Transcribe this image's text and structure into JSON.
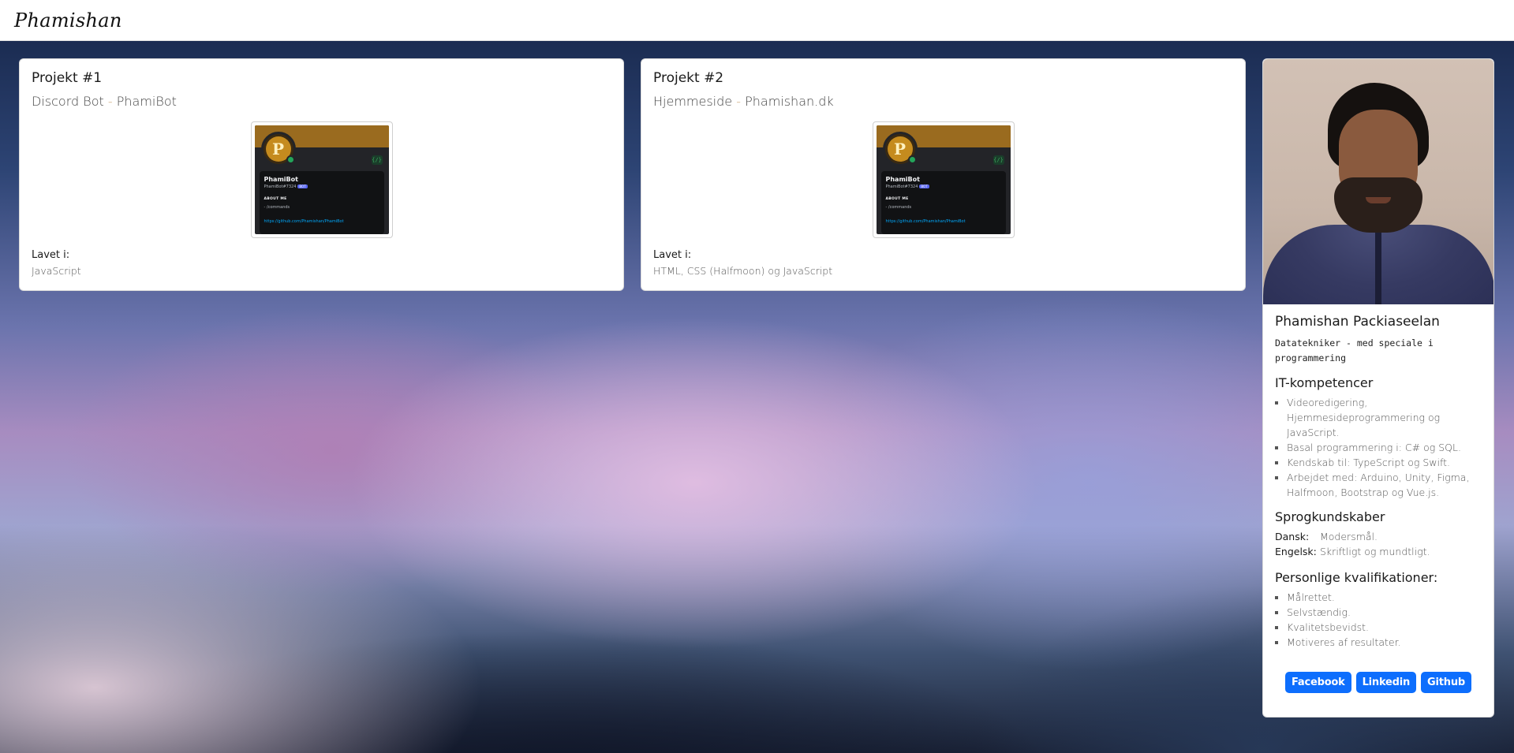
{
  "navbar": {
    "brand": "Phamishan"
  },
  "projects": [
    {
      "title": "Projekt #1",
      "name": "Discord Bot",
      "separator": "-",
      "product": "PhamiBot",
      "made_label": "Lavet i:",
      "made_value": "JavaScript",
      "preview": {
        "avatar_letter": "P",
        "dev_badge": "{/}",
        "bot_name": "PhamiBot",
        "bot_tag": "PhamiBot#7324",
        "bot_badge": "BOT",
        "about_label": "ABOUT ME",
        "commands": "- /commands",
        "link": "https://github.com/Phamishan/PhamiBot"
      }
    },
    {
      "title": "Projekt #2",
      "name": "Hjemmeside",
      "separator": "-",
      "product": "Phamishan.dk",
      "made_label": "Lavet i:",
      "made_value": "HTML, CSS (Halfmoon) og JavaScript",
      "preview": {
        "avatar_letter": "P",
        "dev_badge": "{/}",
        "bot_name": "PhamiBot",
        "bot_tag": "PhamiBot#7324",
        "bot_badge": "BOT",
        "about_label": "ABOUT ME",
        "commands": "- /commands",
        "link": "https://github.com/Phamishan/PhamiBot"
      }
    }
  ],
  "profile": {
    "name": "Phamishan Packiaseelan",
    "role": "Datatekniker - med speciale i programmering",
    "it_title": "IT-kompetencer",
    "it_items": [
      "Videoredigering, Hjemmesideprogrammering og JavaScript.",
      "Basal programmering i: C# og SQL.",
      "Kendskab til: TypeScript og Swift.",
      "Arbejdet med: Arduino, Unity, Figma, Halfmoon, Bootstrap og Vue.js."
    ],
    "lang_title": "Sprogkundskaber",
    "languages": [
      {
        "lang": "Dansk:",
        "level": "Modersmål."
      },
      {
        "lang": "Engelsk:",
        "level": "Skriftligt og mundtligt."
      }
    ],
    "personal_title": "Personlige kvalifikationer:",
    "personal_items": [
      "Målrettet.",
      "Selvstændig.",
      "Kvalitetsbevidst.",
      "Motiveres af resultater."
    ],
    "buttons": {
      "facebook": "Facebook",
      "linkedin": "Linkedin",
      "github": "Github"
    }
  },
  "colors": {
    "button": "#0d6efd",
    "separator": "#c9a06a"
  }
}
